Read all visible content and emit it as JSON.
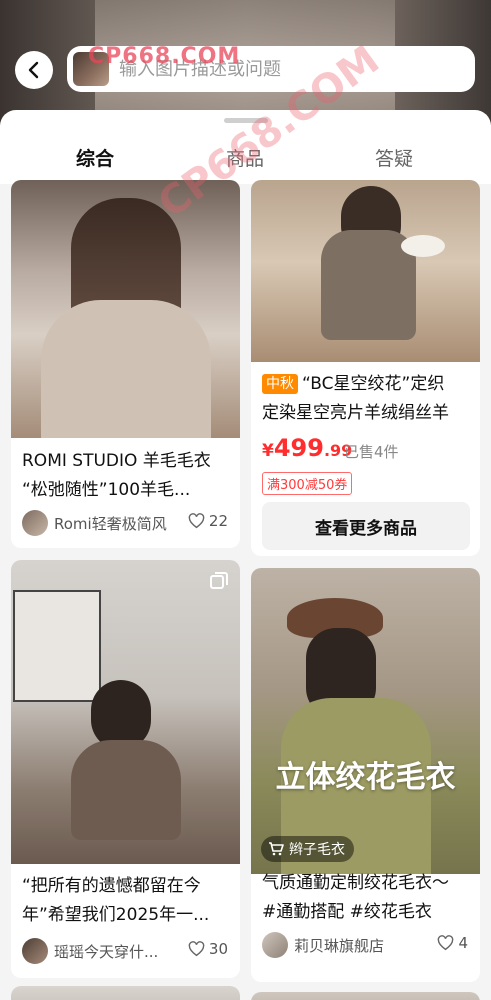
{
  "search": {
    "placeholder": "输入图片描述或问题"
  },
  "watermark": {
    "text": "CP668.COM",
    "text_large": "CP668.COM"
  },
  "tabs": [
    {
      "label": "综合",
      "active": true
    },
    {
      "label": "商品",
      "active": false
    },
    {
      "label": "答疑",
      "active": false
    }
  ],
  "cards": {
    "romi": {
      "title_line1": "ROMI STUDIO 羊毛毛衣",
      "title_line2": "“松弛随性”100羊毛...",
      "author": "Romi轻奢极简风",
      "likes": "22"
    },
    "bc": {
      "tag": "中秋",
      "title_line1": "“BC星空绞花”定织",
      "title_line2": "定染星空亮片羊绒绢丝羊",
      "price_currency": "¥",
      "price_int": "499",
      "price_dec": ".99",
      "sold": "已售4件",
      "coupon": "满300减50券",
      "more_button": "查看更多商品"
    },
    "regret": {
      "title_line1": "“把所有的遗憾都留在今",
      "title_line2": "年”希望我们2025年一...",
      "author": "瑶瑶今天穿什...",
      "likes": "30"
    },
    "knit": {
      "overlay_text": "立体绞花毛衣",
      "overlay_tag": "辫子毛衣",
      "title_line1": "气质通勤定制绞花毛衣～",
      "title_line2": "#通勤搭配 #绞花毛衣",
      "author": "莉贝琳旗舰店",
      "likes": "4"
    }
  },
  "colors": {
    "accent_red": "#ff2d2d",
    "tag_orange": "#ff8a00",
    "tab_active": "#111111"
  }
}
